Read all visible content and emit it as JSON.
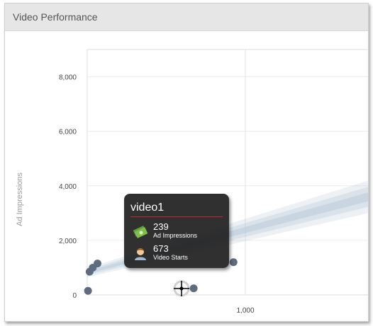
{
  "panel": {
    "title": "Video Performance"
  },
  "chart_data": {
    "type": "scatter",
    "title": "",
    "ylabel": "Ad Impressions",
    "xlabel": "",
    "x_ticks": [
      "1,000"
    ],
    "y_ticks": [
      "0",
      "2,000",
      "4,000",
      "6,000",
      "8,000"
    ],
    "ylim": [
      0,
      9000
    ],
    "xlim": [
      0,
      2100
    ],
    "grid": true,
    "points": [
      {
        "x": 5,
        "y": 150
      },
      {
        "x": 15,
        "y": 850
      },
      {
        "x": 35,
        "y": 1000
      },
      {
        "x": 65,
        "y": 1150
      },
      {
        "x": 673,
        "y": 239
      },
      {
        "x": 925,
        "y": 1200
      }
    ],
    "trend": {
      "x": [
        0,
        2100
      ],
      "y": [
        820,
        4100
      ]
    },
    "highlighted_point": {
      "name": "video1",
      "ad_impressions": 239,
      "video_starts": 673
    }
  },
  "tooltip": {
    "title": "video1",
    "rows": [
      {
        "value": "239",
        "label": "Ad Impressions",
        "icon": "money-icon"
      },
      {
        "value": "673",
        "label": "Video Starts",
        "icon": "person-icon"
      }
    ]
  },
  "colors": {
    "point": "#5d6c80",
    "trend": "#b8c7d8",
    "tooltip_rule": "#c62828"
  }
}
